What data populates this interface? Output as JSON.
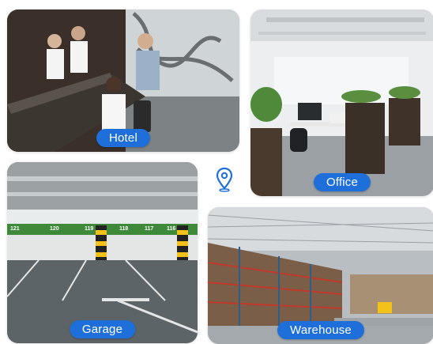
{
  "cards": {
    "hotel": {
      "label": "Hotel"
    },
    "office": {
      "label": "Office"
    },
    "garage": {
      "label": "Garage"
    },
    "warehouse": {
      "label": "Warehouse"
    }
  },
  "garage_stall_numbers": [
    "121",
    "120",
    "119",
    "118",
    "117",
    "116"
  ],
  "center_icon": "location-pin-icon",
  "colors": {
    "accent": "#1e6fd9",
    "garage_green": "#3e8a3a"
  }
}
